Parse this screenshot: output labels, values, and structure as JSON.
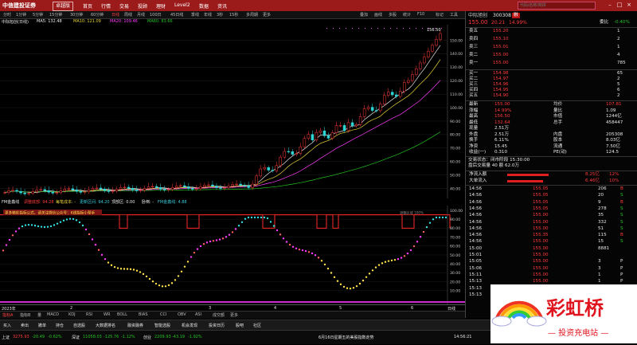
{
  "app": {
    "logo_text": "中信建投证券",
    "edition": "卓越版",
    "menu": [
      "首页",
      "行情",
      "交易",
      "投顾",
      "理财",
      "Level2",
      "数据",
      "资讯"
    ],
    "right_search_placeholder": "代码/名称/简拼",
    "window_buttons": [
      "–",
      "□",
      "×"
    ]
  },
  "toolbar": {
    "periods": [
      "分时",
      "1分钟",
      "5分钟",
      "15分钟",
      "30分钟",
      "60分钟",
      "日线",
      "周线",
      "月线",
      "100日",
      "45日线",
      "季线",
      "年线",
      "3秒",
      "15秒",
      "多周期",
      "更多"
    ],
    "right_items": [
      "叠加",
      "画线",
      "多股",
      "统计",
      "F10",
      "标记",
      "工具"
    ]
  },
  "chart_info": {
    "stock": "中际旭创(日线)",
    "ma5": "MA5: 132.48",
    "ma10": "MA10: 121.09",
    "ma20": "MA20: 109.46",
    "ma60": "MA60: 83.66",
    "high_label": "156.50"
  },
  "sub_info": {
    "title": "FM金鑫线",
    "a": "调整底部: 94.28",
    "b": "每笔成本: -",
    "c": "更新区间: 94.20",
    "d": "顶部区: 0.00",
    "e": "卧倒: -",
    "f": "FM金鑫线: 4.88"
  },
  "sub_banner": "更多精彩指标公式，请关注微信公众号：K线指标小帮手",
  "sub_right_label": "调整区域 100%",
  "y_axis_main": [
    "150.00",
    "140.00",
    "130.00",
    "120.00",
    "110.00",
    "100.00",
    "90.00",
    "80.00",
    "70.00",
    "60.00",
    "50.00",
    "40.00"
  ],
  "y_axis_sub": [
    "100.00",
    "90.00",
    "80.00",
    "70.00",
    "60.00",
    "50.00",
    "40.00",
    "30.00",
    "20.00",
    "10.00"
  ],
  "x_axis": {
    "year": "2023年",
    "months": [
      "2",
      "3",
      "4",
      "5",
      "6"
    ],
    "right_label": "日线"
  },
  "bottom_tabs": [
    "指标A",
    "指标B",
    "量",
    "MACD",
    "KDJ",
    "RSI",
    "WR",
    "BOLL",
    "BIAS",
    "CCI",
    "OBV",
    "ASI",
    "成交额",
    "更多"
  ],
  "quote": {
    "code_title": "中际旭创",
    "code": "300308",
    "tag": "融",
    "price": "155.00",
    "change": "20.21",
    "pct": "14.99%",
    "ask_label": "委比",
    "ask_val": "-0.40%",
    "asks": [
      {
        "name": "卖五",
        "price": "155.20",
        "vol": "1"
      },
      {
        "name": "卖四",
        "price": "155.10",
        "vol": "2"
      },
      {
        "name": "卖三",
        "price": "155.01",
        "vol": "1"
      },
      {
        "name": "卖二",
        "price": "155.00",
        "vol": "4"
      },
      {
        "name": "卖一",
        "price": "155.00",
        "vol": "785"
      }
    ],
    "bids": [
      {
        "name": "买一",
        "price": "154.98",
        "vol": "65"
      },
      {
        "name": "买二",
        "price": "154.97",
        "vol": "2"
      },
      {
        "name": "买三",
        "price": "154.96",
        "vol": "5"
      },
      {
        "name": "买四",
        "price": "154.95",
        "vol": "6"
      },
      {
        "name": "买五",
        "price": "154.90",
        "vol": "2"
      }
    ],
    "stats_left": [
      {
        "k": "最新",
        "v": "155.00"
      },
      {
        "k": "涨幅",
        "v": "14.99%"
      },
      {
        "k": "最高",
        "v": "156.50"
      },
      {
        "k": "最低",
        "v": "132.64"
      },
      {
        "k": "现量",
        "v": "2.51万"
      },
      {
        "k": "外盘",
        "v": "2.51万"
      },
      {
        "k": "换手",
        "v": "6.11%"
      },
      {
        "k": "净资",
        "v": "15.45"
      },
      {
        "k": "收益(一)",
        "v": "0.310"
      }
    ],
    "stats_right": [
      {
        "k": "均价",
        "v": "107.81"
      },
      {
        "k": "量比",
        "v": "1.09"
      },
      {
        "k": "市值",
        "v": "1244亿"
      },
      {
        "k": "总手",
        "v": "458447"
      },
      {
        "k": "内盘",
        "v": "205308"
      },
      {
        "k": "股本",
        "v": "8.03亿"
      },
      {
        "k": "流通",
        "v": "7.50亿"
      },
      {
        "k": "PE(动)",
        "v": "124.5"
      }
    ],
    "notes": [
      "交易状态：闭市阶段 15:30:00",
      "盘后交易量 40 额 62.0万"
    ],
    "flow": [
      {
        "k": "净流入额",
        "v": "8.25亿",
        "p": "12%"
      },
      {
        "k": "大单流入",
        "v": "6.46亿",
        "p": "10%"
      }
    ],
    "ticks": [
      {
        "t": "14:56",
        "p": "155.05",
        "v": "206",
        "s": "B"
      },
      {
        "t": "14:56",
        "p": "155.05",
        "v": "20",
        "s": "S"
      },
      {
        "t": "14:56",
        "p": "155.05",
        "v": "9",
        "s": "B"
      },
      {
        "t": "14:56",
        "p": "155.05",
        "v": "278",
        "s": "S"
      },
      {
        "t": "14:56",
        "p": "155.00",
        "v": "35",
        "s": "S"
      },
      {
        "t": "14:56",
        "p": "155.00",
        "v": "332",
        "s": "S"
      },
      {
        "t": "14:56",
        "p": "155.00",
        "v": "51",
        "s": "S"
      },
      {
        "t": "14:56",
        "p": "155.35",
        "v": "115",
        "s": "B"
      },
      {
        "t": "14:56",
        "p": "155.00",
        "v": "15",
        "s": "S"
      },
      {
        "t": "15:00",
        "p": "155.00",
        "v": "8881",
        "s": ""
      },
      {
        "t": "15:01",
        "p": "155.00",
        "v": "",
        "s": ""
      },
      {
        "t": "15:05",
        "p": "155.00",
        "v": "3",
        "s": "P"
      },
      {
        "t": "15:06",
        "p": "155.00",
        "v": "3",
        "s": "P"
      },
      {
        "t": "15:11",
        "p": "155.00",
        "v": "1",
        "s": "P"
      },
      {
        "t": "15:13",
        "p": "155.00",
        "v": "1",
        "s": "P"
      },
      {
        "t": "15:13",
        "p": "155.00",
        "v": "3",
        "s": "P"
      },
      {
        "t": "15:13",
        "p": "155.00",
        "v": "3",
        "s": "P"
      }
    ]
  },
  "status": {
    "items": [
      "买入",
      "卖出",
      "撤单",
      "持仓",
      "自选股",
      "大数据排名",
      "融资融券",
      "智能选股",
      "机会发现",
      "投资日历",
      "股吧",
      "社区"
    ],
    "index": [
      {
        "name": "上证",
        "val": "3275.93",
        "chg": "-20.49",
        "pct": "-0.62%"
      },
      {
        "name": "深证",
        "val": "11058.03",
        "chg": "-125.76",
        "pct": "-1.12%"
      },
      {
        "name": "创业",
        "val": "2209.93",
        "chg": "-43.19",
        "pct": "-1.92%"
      }
    ],
    "ticker": "6月16日星期五的美股指数走势",
    "time": "14:56:21"
  },
  "ad": {
    "main": "彩虹桥",
    "sub": "— 投资充电站 —"
  },
  "colors": {
    "red": "#ff3b3b",
    "green": "#25c225",
    "yellow": "#e8d03a",
    "magenta": "#ff3cff",
    "cyan": "#35c9d8"
  }
}
